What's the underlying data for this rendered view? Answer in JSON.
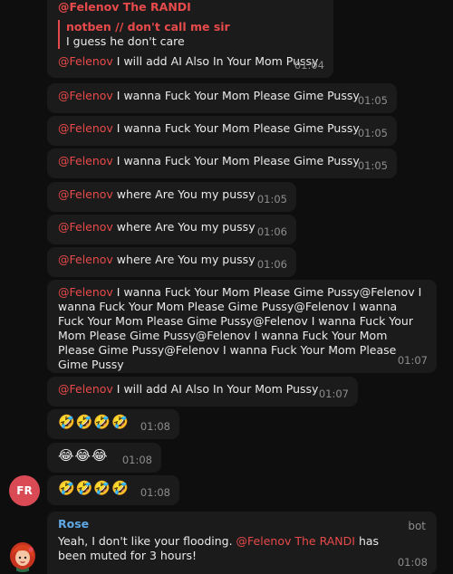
{
  "messages": {
    "m1": {
      "sender": "@Felenov The RANDI",
      "reply_author": "notben // don't call me sir",
      "reply_text": "I guess he don't care",
      "mention": "@Felenov",
      "text": " I will add AI Also In Your Mom Pussy",
      "time": "01:04"
    },
    "m2": {
      "mention": "@Felenov",
      "text": " I wanna Fuck Your Mom Please Gime Pussy",
      "time": "01:05"
    },
    "m3": {
      "mention": "@Felenov",
      "text": " I wanna Fuck Your Mom Please Gime Pussy",
      "time": "01:05"
    },
    "m4": {
      "mention": "@Felenov",
      "text": " I wanna Fuck Your Mom Please Gime Pussy",
      "time": "01:05"
    },
    "m5": {
      "mention": "@Felenov",
      "text": " where Are You my pussy",
      "time": "01:05"
    },
    "m6": {
      "mention": "@Felenov",
      "text": " where Are You my pussy",
      "time": "01:06"
    },
    "m7": {
      "mention": "@Felenov",
      "text": " where Are You my pussy",
      "time": "01:06"
    },
    "m8": {
      "mention": "@Felenov",
      "text": " I wanna Fuck Your Mom Please Gime Pussy@Felenov I wanna Fuck Your Mom Please Gime Pussy@Felenov I wanna Fuck Your Mom Please Gime Pussy@Felenov I wanna Fuck Your Mom Please Gime Pussy@Felenov I wanna Fuck Your Mom Please Gime Pussy@Felenov I wanna Fuck Your Mom Please Gime Pussy",
      "time": "01:07"
    },
    "m9": {
      "mention": "@Felenov",
      "text": " I will add AI Also In Your Mom Pussy",
      "time": "01:07"
    },
    "m10": {
      "emoji": "🤣🤣🤣🤣",
      "time": "01:08"
    },
    "m11": {
      "emoji": "😂😂😂",
      "time": "01:08"
    },
    "m12": {
      "emoji": "🤣🤣🤣🤣",
      "time": "01:08"
    },
    "m13": {
      "sender": "Rose",
      "bot_tag": "bot",
      "text_before": "Yeah, I don't like your flooding. ",
      "mention": "@Felenov The RANDI",
      "text_after": " has been muted for 3 hours!",
      "time": "01:08"
    }
  },
  "avatars": {
    "fr_initials": "FR"
  },
  "colors": {
    "background": "#0e0e0e",
    "bubble": "#1b1b1b",
    "mention": "#e74a4a",
    "rose_name": "#5fa8e6",
    "avatar_fr": "#d94a55"
  }
}
